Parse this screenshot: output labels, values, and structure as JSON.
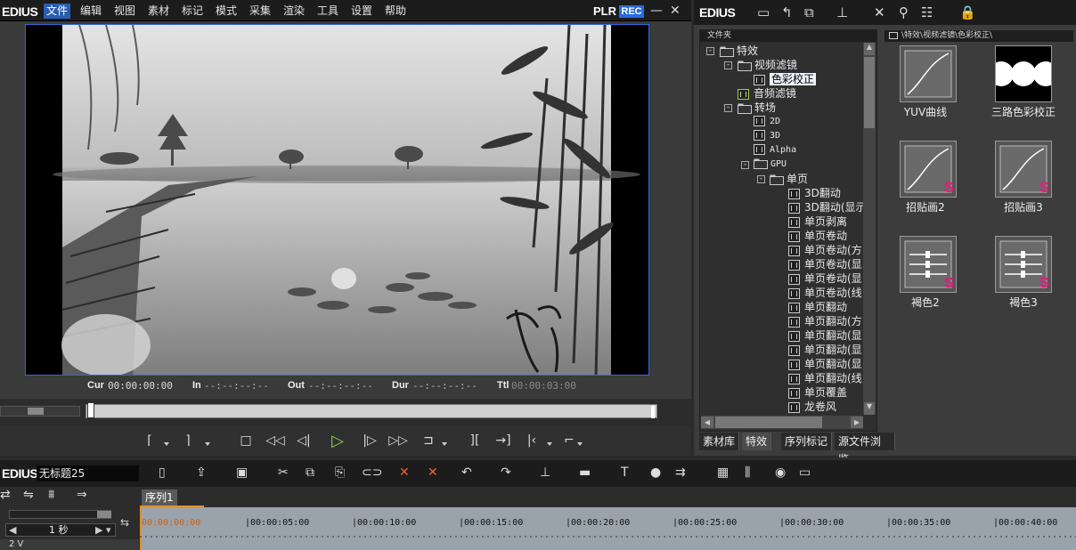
{
  "player": {
    "logo": "EDIUS",
    "menu": [
      "文件",
      "编辑",
      "视图",
      "素材",
      "标记",
      "模式",
      "采集",
      "渲染",
      "工具",
      "设置",
      "帮助"
    ],
    "plr": "PLR",
    "rec": "REC",
    "minimize": "—",
    "close": "✕",
    "timecode": {
      "cur_label": "Cur",
      "cur_value": "00:00:00:00",
      "in_label": "In",
      "in_value": "--:--:--:--",
      "out_label": "Out",
      "out_value": "--:--:--:--",
      "dur_label": "Dur",
      "dur_value": "--:--:--:--",
      "ttl_label": "Ttl",
      "ttl_value": "00:00:03:00"
    }
  },
  "effects_panel": {
    "logo": "EDIUS",
    "folder_header": "文件夹",
    "path_header": "\\特效\\视频滤镜\\色彩校正\\",
    "tree": [
      {
        "label": "特效"
      },
      {
        "label": "视频滤镜"
      },
      {
        "label": "色彩校正"
      },
      {
        "label": "音频滤镜"
      },
      {
        "label": "转场"
      },
      {
        "label": "2D"
      },
      {
        "label": "3D"
      },
      {
        "label": "Alpha"
      },
      {
        "label": "GPU"
      },
      {
        "label": "单页"
      },
      {
        "label": "3D翻动"
      },
      {
        "label": "3D翻动(显示"
      },
      {
        "label": "单页剥离"
      },
      {
        "label": "单页卷动"
      },
      {
        "label": "单页卷动(方"
      },
      {
        "label": "单页卷动(显"
      },
      {
        "label": "单页卷动(显"
      },
      {
        "label": "单页卷动(线"
      },
      {
        "label": "单页翻动"
      },
      {
        "label": "单页翻动(方"
      },
      {
        "label": "单页翻动(显"
      },
      {
        "label": "单页翻动(显"
      },
      {
        "label": "单页翻动(显"
      },
      {
        "label": "单页翻动(线"
      },
      {
        "label": "单页覆盖"
      },
      {
        "label": "龙卷风"
      }
    ],
    "effects": [
      {
        "label": "YUV曲线",
        "icon": "curve-icon"
      },
      {
        "label": "三路色彩校正",
        "icon": "three-way-icon"
      },
      {
        "label": "招贴画2",
        "icon": "curve-icon"
      },
      {
        "label": "招贴画3",
        "icon": "curve-icon"
      },
      {
        "label": "褐色2",
        "icon": "slider-icon"
      },
      {
        "label": "褐色3",
        "icon": "slider-icon"
      }
    ],
    "tabs": [
      "素材库",
      "特效",
      "序列标记",
      "源文件浏览"
    ],
    "active_tab": "特效",
    "s_badge": "S"
  },
  "timeline": {
    "logo": "EDIUS",
    "project_name": "无标题25",
    "sequence_tab": "序列1",
    "zoom_label": "1 秒",
    "track_label": "2 V",
    "ruler": [
      "00:00:00:00",
      "|00:00:05:00",
      "|00:00:10:00",
      "|00:00:15:00",
      "|00:00:20:00",
      "|00:00:25:00",
      "|00:00:30:00",
      "|00:00:35:00",
      "|00:00:40:00"
    ]
  },
  "colors": {
    "accent": "#2a5db0",
    "rec": "#2a6ae0",
    "badge": "#e8197a",
    "play": "#9ad040"
  }
}
